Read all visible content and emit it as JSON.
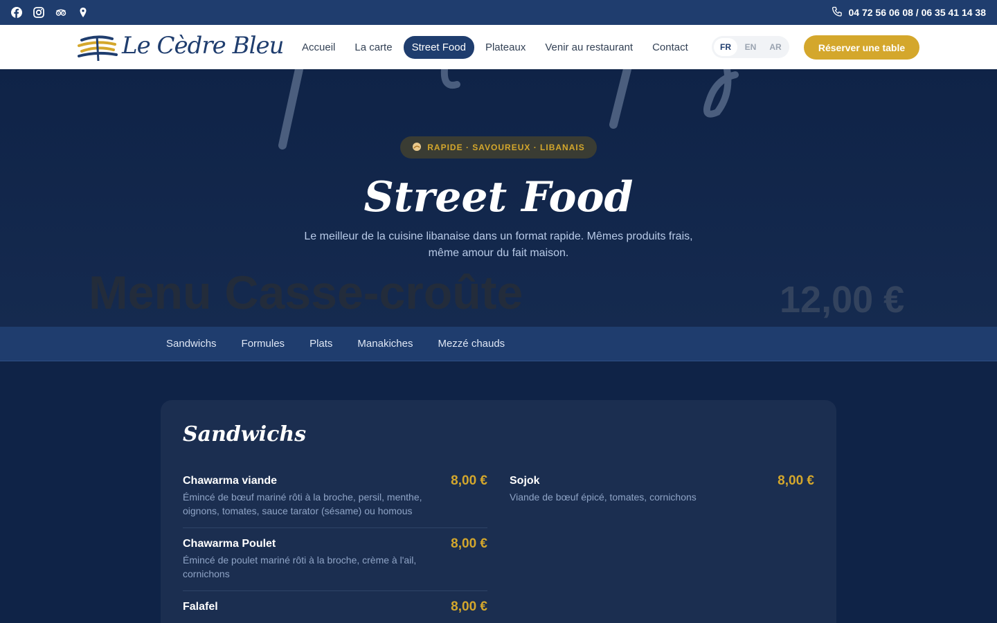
{
  "topbar": {
    "social_icons": [
      "facebook-icon",
      "instagram-icon",
      "tripadvisor-icon",
      "map-pin-icon"
    ],
    "phone": "04 72 56 06 08 / 06 35 41 14 38"
  },
  "header": {
    "logo_text": "Le Cèdre Bleu",
    "nav": [
      "Accueil",
      "La carte",
      "Street Food",
      "Plateaux",
      "Venir au restaurant",
      "Contact"
    ],
    "active_nav": "Street Food",
    "languages": [
      "FR",
      "EN",
      "AR"
    ],
    "active_language": "FR",
    "reserve_label": "Réserver une table"
  },
  "hero": {
    "badge": "RAPIDE · SAVOUREUX · LIBANAIS",
    "title": "Street Food",
    "subtitle": "Le meilleur de la cuisine libanaise dans un format rapide. Mêmes produits frais, même amour du fait maison.",
    "ghost_title": "Menu Casse-croûte",
    "ghost_price": "12,00 €"
  },
  "categories": [
    "Sandwichs",
    "Formules",
    "Plats",
    "Manakiches",
    "Mezzé chauds"
  ],
  "section": {
    "title": "Sandwichs",
    "left_items": [
      {
        "name": "Chawarma viande",
        "desc": "Émincé de bœuf mariné rôti à la broche, persil, menthe, oignons, tomates, sauce tarator (sésame) ou homous",
        "price": "8,00 €"
      },
      {
        "name": "Chawarma Poulet",
        "desc": "Émincé de poulet mariné rôti à la broche, crème à l'ail, cornichons",
        "price": "8,00 €"
      },
      {
        "name": "Falafel",
        "desc": "",
        "price": "8,00 €"
      }
    ],
    "right_items": [
      {
        "name": "Sojok",
        "desc": "Viande de bœuf épicé, tomates, cornichons",
        "price": "8,00 €"
      }
    ]
  },
  "colors": {
    "primary": "#1f3d6e",
    "accent": "#d4a72c",
    "background": "#0f2347"
  }
}
